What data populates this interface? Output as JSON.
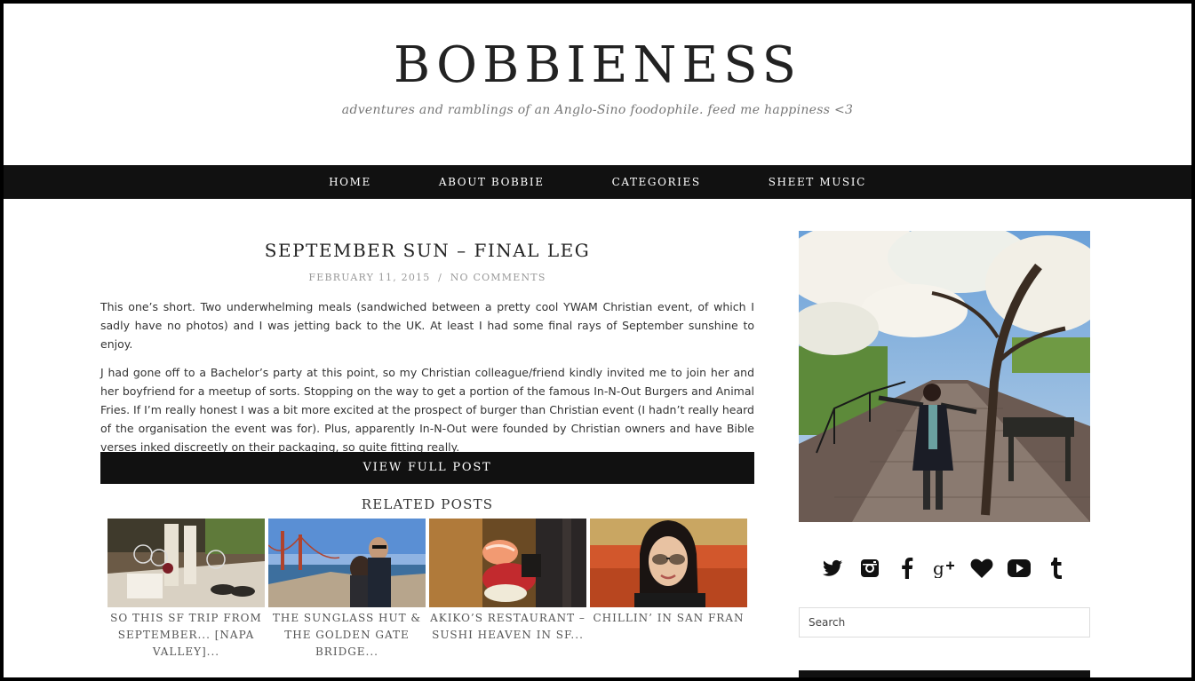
{
  "site": {
    "title": "BOBBIENESS",
    "tagline": "adventures and ramblings of an Anglo-Sino foodophile. feed me happiness <3"
  },
  "nav": {
    "items": [
      {
        "label": "HOME"
      },
      {
        "label": "ABOUT BOBBIE"
      },
      {
        "label": "CATEGORIES"
      },
      {
        "label": "SHEET MUSIC"
      }
    ]
  },
  "post": {
    "title": "SEPTEMBER SUN – FINAL LEG",
    "date": "FEBRUARY 11, 2015",
    "separator": "/",
    "comments": "NO COMMENTS",
    "paragraphs": [
      "This one’s short. Two underwhelming meals (sandwiched between a pretty cool YWAM Christian event, of which I sadly have no photos) and I was jetting back to the UK. At least I had some final rays of September sunshine to enjoy.",
      "J had gone off to a Bachelor’s party at this point, so my Christian colleague/friend kindly invited me to join her and her boyfriend for a meetup of sorts. Stopping on the way to get a portion of the famous In-N-Out Burgers and Animal Fries. If I’m really honest I was a bit more excited at the prospect of burger than Christian event (I hadn’t really heard of the organisation the event was for). Plus, apparently In-N-Out were founded by Christian owners and have Bible verses inked discreetly on their packaging, so quite fitting really."
    ],
    "view_full_label": "VIEW FULL POST"
  },
  "related": {
    "heading": "RELATED POSTS",
    "items": [
      {
        "caption": "SO THIS SF TRIP FROM SEPTEMBER... [NAPA VALLEY]..."
      },
      {
        "caption": "THE SUNGLASS HUT & THE GOLDEN GATE BRIDGE..."
      },
      {
        "caption": "AKIKO’S RESTAURANT – SUSHI HEAVEN IN SF..."
      },
      {
        "caption": "CHILLIN’ IN SAN FRAN"
      }
    ]
  },
  "sidebar": {
    "social_icons": [
      "twitter-icon",
      "instagram-icon",
      "facebook-icon",
      "google-plus-icon",
      "heart-icon",
      "youtube-icon",
      "tumblr-icon"
    ],
    "search_placeholder": "Search"
  },
  "colors": {
    "nav_bg": "#111111",
    "title_text": "#222222",
    "tagline_text": "#777777"
  }
}
